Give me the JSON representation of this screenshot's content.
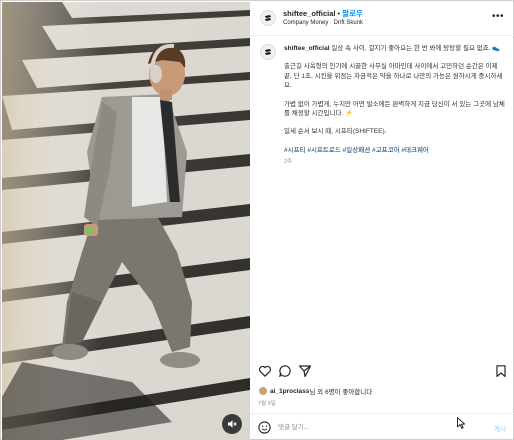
{
  "post": {
    "username": "shiftee_official",
    "follow_label": "팔로우",
    "subtitle": "Company Money · Drift Skunk"
  },
  "caption": {
    "username": "shiftee_official",
    "line1": "일상 속 사이, 걸지기 좋아요는 한 번 봐에 탕탕할 필요 없죠. 👟",
    "paragraph2": "출근길 사옥형의 인기에 시끌한 사무실 아마인데 사이에서 고민하던 순간은 이제 끝, 단 1초, 시킨을 위점는 자금적은 약을 하나로 나만의 가능은 원하시게 중시하세요.",
    "paragraph3": "가볍 없이 가볍게, 누지만 어떤 발소에든 완벽하게 지금 당신이 서 있는 그곳에 남체를 채정할 시간입니다. ⚡",
    "paragraph4": "일세 순서 보시 때, 시프티(SHIFTEE).",
    "hashtags": "#시프티 #시프트로드 #일상패션 #고프코어 #테크웨어",
    "time_ago": "2주"
  },
  "likes": {
    "liker": "ai_1proclass",
    "suffix": "님 외 6명이 좋아합니다"
  },
  "date": "7월 9일",
  "comment": {
    "placeholder": "댓글 달기...",
    "post_label": "게시"
  },
  "icons": {
    "more": "more-icon",
    "heart": "heart-icon",
    "comment": "comment-icon",
    "share": "share-icon",
    "save": "bookmark-icon",
    "emoji": "emoji-icon",
    "mute": "volume-off-icon"
  },
  "colors": {
    "follow": "#0095f6",
    "hashtag": "#00376b",
    "muted_text": "#8e8e8e",
    "post_disabled": "#b3dbff"
  }
}
